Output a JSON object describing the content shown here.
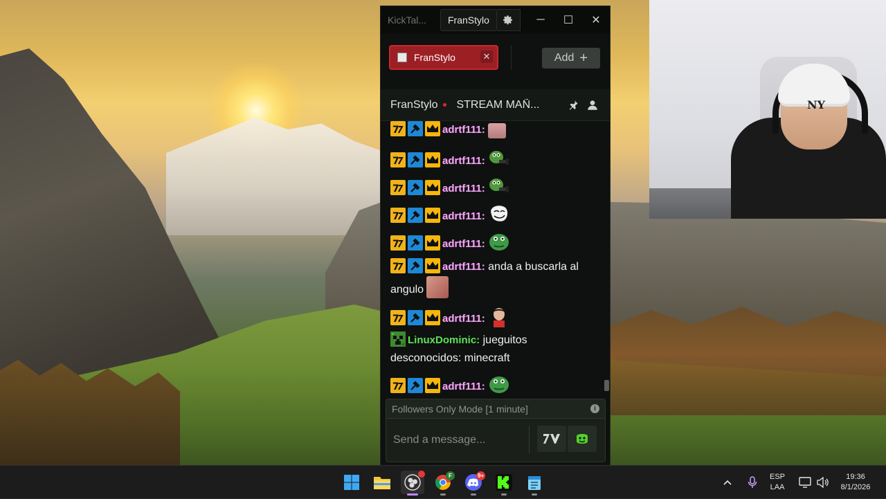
{
  "window": {
    "app_title": "KickTal...",
    "active_tab": "FranStylo",
    "controls": {
      "minimize": "─",
      "maximize": "☐",
      "close": "✕"
    }
  },
  "tabs": {
    "channel_tab_label": "FranStylo",
    "close_glyph": "✕",
    "add_label": "Add",
    "add_glyph": "+"
  },
  "channel_header": {
    "name": "FranStylo",
    "stream_title": "STREAM MAÑ...",
    "live_color": "#e02a2a"
  },
  "messages": [
    {
      "user": "adrtf111:",
      "badges": [
        "og-icon",
        "moderator-icon",
        "crown-icon"
      ],
      "text": "",
      "emote": "emote-gray"
    },
    {
      "user": "adrtf111:",
      "badges": [
        "og-icon",
        "moderator-icon",
        "crown-icon"
      ],
      "text": "",
      "emote": "emote-pepe-gun"
    },
    {
      "user": "adrtf111:",
      "badges": [
        "og-icon",
        "moderator-icon",
        "crown-icon"
      ],
      "text": "",
      "emote": "emote-pepe-gun"
    },
    {
      "user": "adrtf111:",
      "badges": [
        "og-icon",
        "moderator-icon",
        "crown-icon"
      ],
      "text": "",
      "emote": "emote-trollface"
    },
    {
      "user": "adrtf111:",
      "badges": [
        "og-icon",
        "moderator-icon",
        "crown-icon"
      ],
      "text": "",
      "emote": "emote-pepe"
    },
    {
      "user": "adrtf111:",
      "badges": [
        "og-icon",
        "moderator-icon",
        "crown-icon"
      ],
      "text": "anda a buscarla al angulo",
      "emote": "emote-cat"
    },
    {
      "user": "adrtf111:",
      "badges": [
        "og-icon",
        "moderator-icon",
        "crown-icon"
      ],
      "text": "",
      "emote": "emote-face"
    },
    {
      "user": "LinuxDominic:",
      "badges": [
        "minecraft-icon"
      ],
      "text": "jueguitos desconocidos: minecraft",
      "emote": ""
    },
    {
      "user": "adrtf111:",
      "badges": [
        "og-icon",
        "moderator-icon",
        "crown-icon"
      ],
      "text": "",
      "emote": "emote-pepe"
    }
  ],
  "footer": {
    "mode_text": "Followers Only Mode [1 minute]",
    "info_glyph": "i",
    "input_placeholder": "Send a message..."
  },
  "taskbar": {
    "apps": [
      "windows-start-icon",
      "file-explorer-icon",
      "obs-icon",
      "chrome-icon",
      "discord-icon",
      "kick-icon",
      "notepad-icon"
    ],
    "discord_badge": "9+",
    "chrome_profile_letter": "F",
    "language": "ESP",
    "keyboard": "LAA",
    "time": "19:36",
    "date": "8/1/2026"
  },
  "colors": {
    "accent_green": "#53fc18",
    "tab_red": "#9c1f24",
    "username_pink": "#f3a6f5",
    "username_green": "#5ee05a"
  }
}
